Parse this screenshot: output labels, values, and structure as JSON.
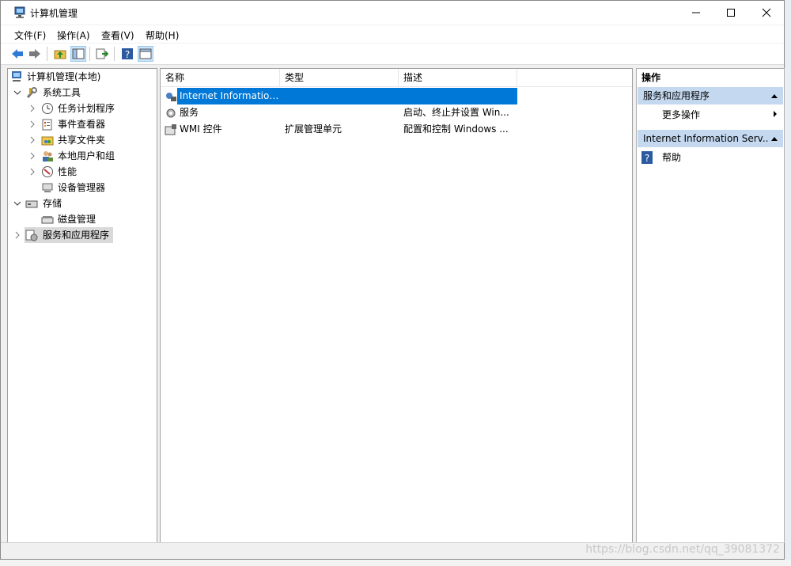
{
  "window": {
    "title": "计算机管理",
    "controls": [
      "minimize",
      "maximize",
      "close"
    ]
  },
  "menu": [
    "文件(F)",
    "操作(A)",
    "查看(V)",
    "帮助(H)"
  ],
  "toolbar": [
    "back-arrow-icon",
    "forward-arrow-icon",
    "up-folder-icon",
    "show-hide-tree-icon",
    "export-list-icon",
    "help-icon",
    "show-hide-action-pane-icon"
  ],
  "tree": [
    {
      "label": "计算机管理(本地)",
      "icon": "computer-management-icon",
      "toggle": ""
    },
    {
      "label": "系统工具",
      "icon": "system-tools-icon",
      "toggle": "v"
    },
    {
      "label": "任务计划程序",
      "icon": "task-scheduler-icon",
      "toggle": ">"
    },
    {
      "label": "事件查看器",
      "icon": "event-viewer-icon",
      "toggle": ">"
    },
    {
      "label": "共享文件夹",
      "icon": "shared-folders-icon",
      "toggle": ">"
    },
    {
      "label": "本地用户和组",
      "icon": "local-users-icon",
      "toggle": ">"
    },
    {
      "label": "性能",
      "icon": "performance-icon",
      "toggle": ">"
    },
    {
      "label": "设备管理器",
      "icon": "device-manager-icon",
      "toggle": ""
    },
    {
      "label": "存储",
      "icon": "storage-icon",
      "toggle": "v"
    },
    {
      "label": "磁盘管理",
      "icon": "disk-management-icon",
      "toggle": ""
    },
    {
      "label": "服务和应用程序",
      "icon": "services-applications-icon",
      "toggle": ">"
    }
  ],
  "list": {
    "columns": [
      "名称",
      "类型",
      "描述"
    ],
    "rows": [
      {
        "name": "Internet Information...",
        "type": "",
        "desc": "",
        "icon": "iis-icon",
        "selected": true
      },
      {
        "name": "服务",
        "type": "",
        "desc": "启动、终止并设置 Win...",
        "icon": "services-icon",
        "selected": false
      },
      {
        "name": "WMI 控件",
        "type": "扩展管理单元",
        "desc": "配置和控制 Windows ...",
        "icon": "wmi-control-icon",
        "selected": false
      }
    ]
  },
  "actions": {
    "header": "操作",
    "sections": [
      {
        "title": "服务和应用程序",
        "items": [
          {
            "label": "更多操作",
            "icon": "",
            "submenu": true
          }
        ]
      },
      {
        "title": "Internet Information Serv...",
        "items": [
          {
            "label": "帮助",
            "icon": "help-icon",
            "submenu": false
          }
        ]
      }
    ]
  },
  "watermark": "https://blog.csdn.net/qq_39081372",
  "colors": {
    "selection": "#0078d7",
    "section_bg": "#c4d9f0",
    "tree_selected": "#d9d9d9"
  }
}
